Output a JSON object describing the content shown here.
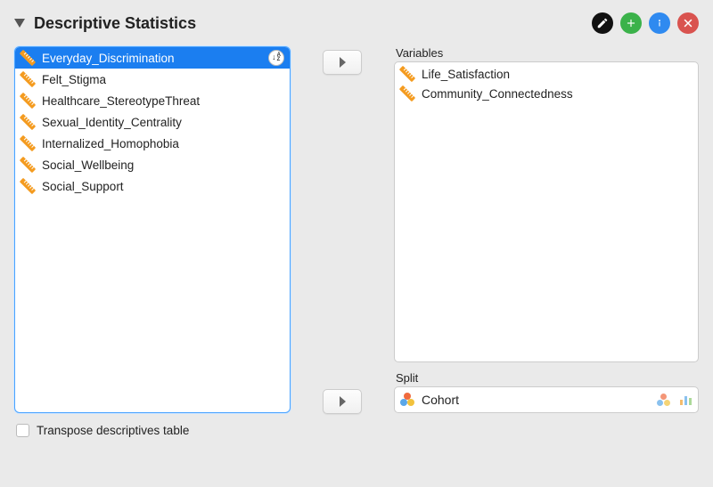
{
  "header": {
    "title": "Descriptive Statistics"
  },
  "source_list": {
    "selected_index": 0,
    "items": [
      "Everyday_Discrimination",
      "Felt_Stigma",
      "Healthcare_StereotypeThreat",
      "Sexual_Identity_Centrality",
      "Internalized_Homophobia",
      "Social_Wellbeing",
      "Social_Support"
    ]
  },
  "variables": {
    "label": "Variables",
    "items": [
      "Life_Satisfaction",
      "Community_Connectedness"
    ]
  },
  "split": {
    "label": "Split",
    "value": "Cohort"
  },
  "footer": {
    "transpose_label": "Transpose descriptives table",
    "transpose_checked": false
  }
}
